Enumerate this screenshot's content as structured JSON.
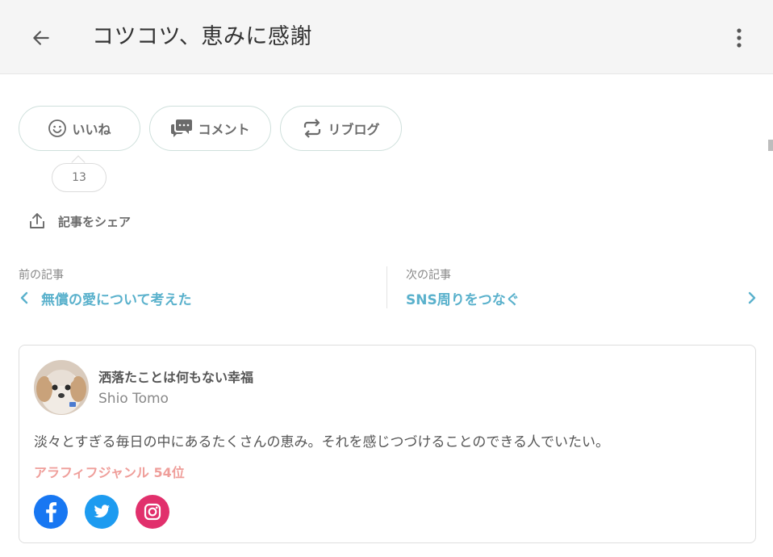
{
  "header": {
    "title": "コツコツ、恵みに感謝",
    "back_icon": "arrow-left-icon",
    "more_icon": "more-vertical-icon"
  },
  "actions": {
    "like_label": "いいね",
    "comment_label": "コメント",
    "reblog_label": "リブログ",
    "like_count": "13",
    "share_label": "記事をシェア"
  },
  "article_nav": {
    "prev_label": "前の記事",
    "prev_title": "無償の愛について考えた",
    "next_label": "次の記事",
    "next_title": "SNS周りをつなぐ"
  },
  "profile": {
    "blog_name": "洒落たことは何もない幸福",
    "author": "Shio Tomo",
    "description": "淡々とすぎる毎日の中にあるたくさんの恵み。それを感じつづけることのできる人でいたい。",
    "genre_rank": "アラフィフジャンル 54位",
    "social": [
      "facebook-icon",
      "twitter-icon",
      "instagram-icon"
    ]
  },
  "colors": {
    "accent_link": "#5ab1cc",
    "rank": "#ef9e9a",
    "facebook": "#1877f2",
    "twitter": "#1d9bf0",
    "instagram": "#e1306c"
  }
}
